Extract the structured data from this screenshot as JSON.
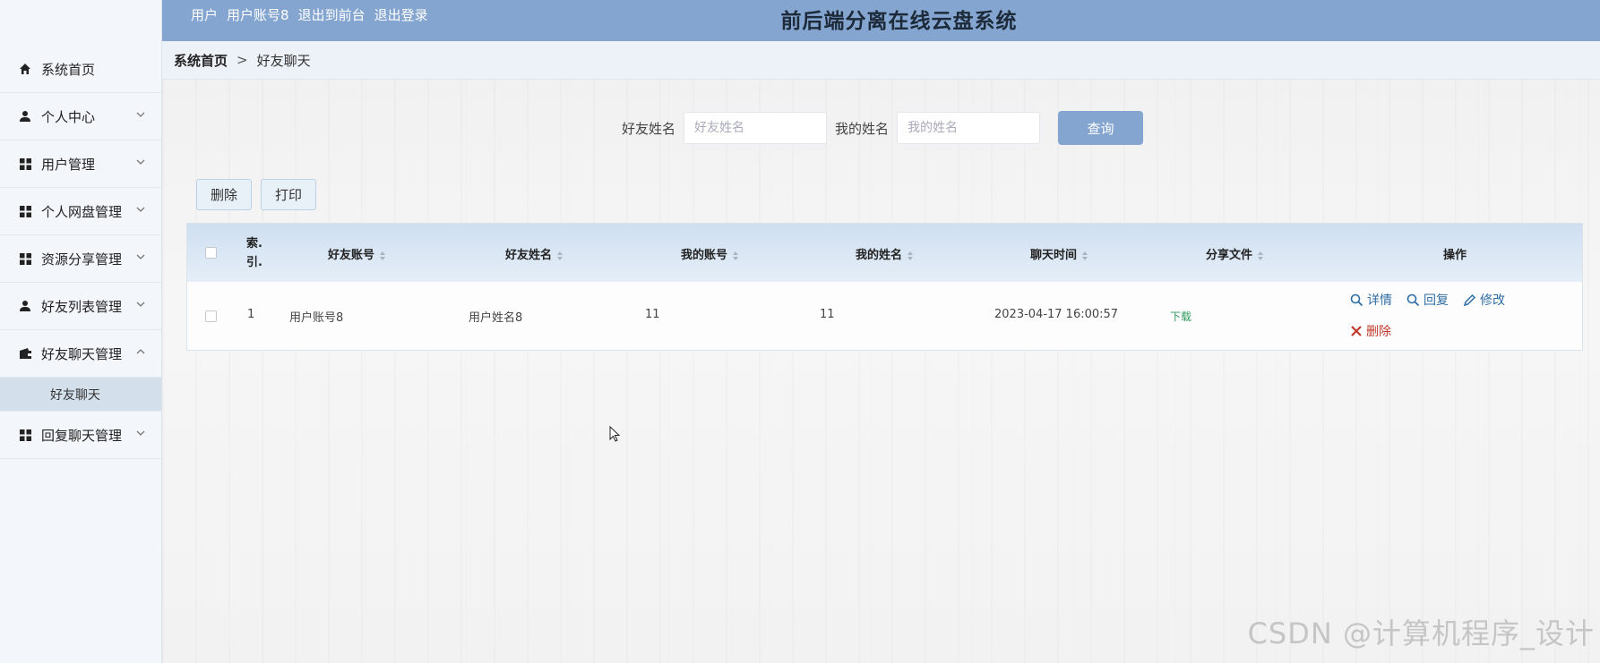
{
  "header": {
    "role": "用户",
    "account": "用户账号8",
    "front_link": "退出到前台",
    "logout_link": "退出登录",
    "title": "前后端分离在线云盘系统"
  },
  "sidebar": {
    "items": [
      {
        "label": "系统首页",
        "icon": "home-icon"
      },
      {
        "label": "个人中心",
        "icon": "user-icon"
      },
      {
        "label": "用户管理",
        "icon": "grid-icon"
      },
      {
        "label": "个人网盘管理",
        "icon": "grid-icon"
      },
      {
        "label": "资源分享管理",
        "icon": "grid-icon"
      },
      {
        "label": "好友列表管理",
        "icon": "user-icon"
      },
      {
        "label": "好友聊天管理",
        "icon": "wallet-icon"
      },
      {
        "label": "回复聊天管理",
        "icon": "grid-icon"
      }
    ],
    "submenu_active": "好友聊天"
  },
  "breadcrumb": {
    "home": "系统首页",
    "separator": ">",
    "current": "好友聊天"
  },
  "search": {
    "friend_name_label": "好友姓名",
    "friend_name_placeholder": "好友姓名",
    "my_name_label": "我的姓名",
    "my_name_placeholder": "我的姓名",
    "query_button": "查询"
  },
  "actions": {
    "delete": "删除",
    "print": "打印"
  },
  "table": {
    "headers": {
      "index_line1": "索.",
      "index_line2": "引.",
      "friend_account": "好友账号",
      "friend_name": "好友姓名",
      "my_account": "我的账号",
      "my_name": "我的姓名",
      "chat_time": "聊天时间",
      "shared_file": "分享文件",
      "operations": "操作"
    },
    "rows": [
      {
        "index": "1",
        "friend_account": "用户账号8",
        "friend_name": "用户姓名8",
        "my_account": "11",
        "my_name": "11",
        "chat_time": "2023-04-17 16:00:57",
        "shared_file": "下载",
        "ops": {
          "detail": "详情",
          "reply": "回复",
          "edit": "修改",
          "delete": "删除"
        }
      }
    ]
  },
  "watermark": "CSDN @计算机程序_设计",
  "colors": {
    "header_bg": "#84a5cf",
    "sidebar_active": "#d3dfeb",
    "link_blue": "#2e6da4",
    "delete_red": "#c0392b",
    "download_green": "#2f9a5d"
  }
}
